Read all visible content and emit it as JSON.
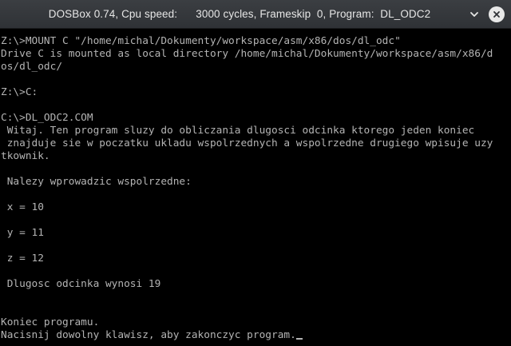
{
  "window": {
    "title": "DOSBox 0.74, Cpu speed:      3000 cycles, Frameskip  0, Program:  DL_ODC2",
    "minimize_icon": "chevron-down-icon",
    "close_icon": "close-icon"
  },
  "terminal": {
    "lines": [
      "Z:\\>MOUNT C \"/home/michal/Dokumenty/workspace/asm/x86/dos/dl_odc\"",
      "Drive C is mounted as local directory /home/michal/Dokumenty/workspace/asm/x86/d",
      "os/dl_odc/",
      "",
      "Z:\\>C:",
      "",
      "C:\\>DL_ODC2.COM",
      " Witaj. Ten program sluzy do obliczania dlugosci odcinka ktorego jeden koniec",
      " znajduje sie w poczatku ukladu wspolrzednych a wspolrzedne drugiego wpisuje uzy",
      "tkownik.",
      "",
      " Nalezy wprowadzic wspolrzedne:",
      "",
      " x = 10",
      "",
      " y = 11",
      "",
      " z = 12",
      "",
      " Dlugosc odcinka wynosi 19",
      "",
      "",
      "Koniec programu.",
      "Nacisnij dowolny klawisz, aby zakonczyc program."
    ]
  },
  "colors": {
    "text": "#b4b4b4",
    "background": "#000000",
    "titlebar": "#35383c"
  }
}
